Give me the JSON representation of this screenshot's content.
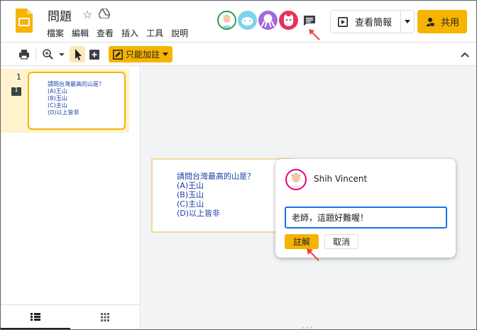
{
  "doc": {
    "title": "問題"
  },
  "menu": [
    "檔案",
    "編輯",
    "查看",
    "插入",
    "工具",
    "說明"
  ],
  "header": {
    "present_label": "查看簡報",
    "share_label": "共用"
  },
  "toolbar": {
    "comment_mode_label": "只能加註"
  },
  "filmstrip": {
    "slide_number": "1",
    "comment_count": "1",
    "thumb_lines": [
      "請問台灣最高的山是？",
      "(A)王山",
      "(B)玉山",
      "(C)主山",
      "(D)以上皆非"
    ]
  },
  "slide": {
    "lines": [
      "請問台灣最高的山是？",
      "(A)王山",
      "(B)玉山",
      "(C)主山",
      "(D)以上皆非"
    ]
  },
  "comment": {
    "user": "Shih Vincent",
    "input_value": "老師，這題好難喔！",
    "submit_label": "註解",
    "cancel_label": "取消"
  },
  "colors": {
    "accent": "#f6b400",
    "focus": "#1a73e8",
    "slide_text": "#1a3fa6",
    "annotation_arrow": "#e5473a"
  }
}
